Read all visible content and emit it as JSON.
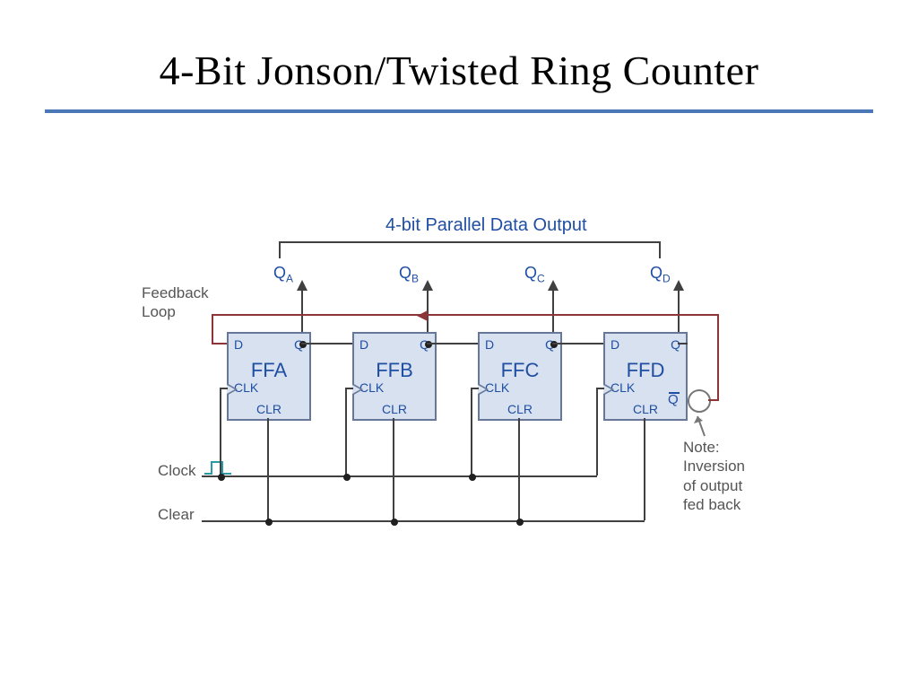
{
  "title": "4-Bit Jonson/Twisted Ring Counter",
  "parallel_label": "4-bit Parallel Data Output",
  "feedback_label": "Feedback\nLoop",
  "clock_label": "Clock",
  "clear_label": "Clear",
  "note_label": "Note:\nInversion\nof output\nfed back",
  "outputs": {
    "qa": "Q",
    "qa_sub": "A",
    "qb": "Q",
    "qb_sub": "B",
    "qc": "Q",
    "qc_sub": "C",
    "qd": "Q",
    "qd_sub": "D"
  },
  "ff": {
    "d": "D",
    "q": "Q",
    "clk": "CLK",
    "clr": "CLR",
    "qbar": "Q",
    "a": "FFA",
    "b": "FFB",
    "c": "FFC",
    "d_name": "FFD"
  }
}
